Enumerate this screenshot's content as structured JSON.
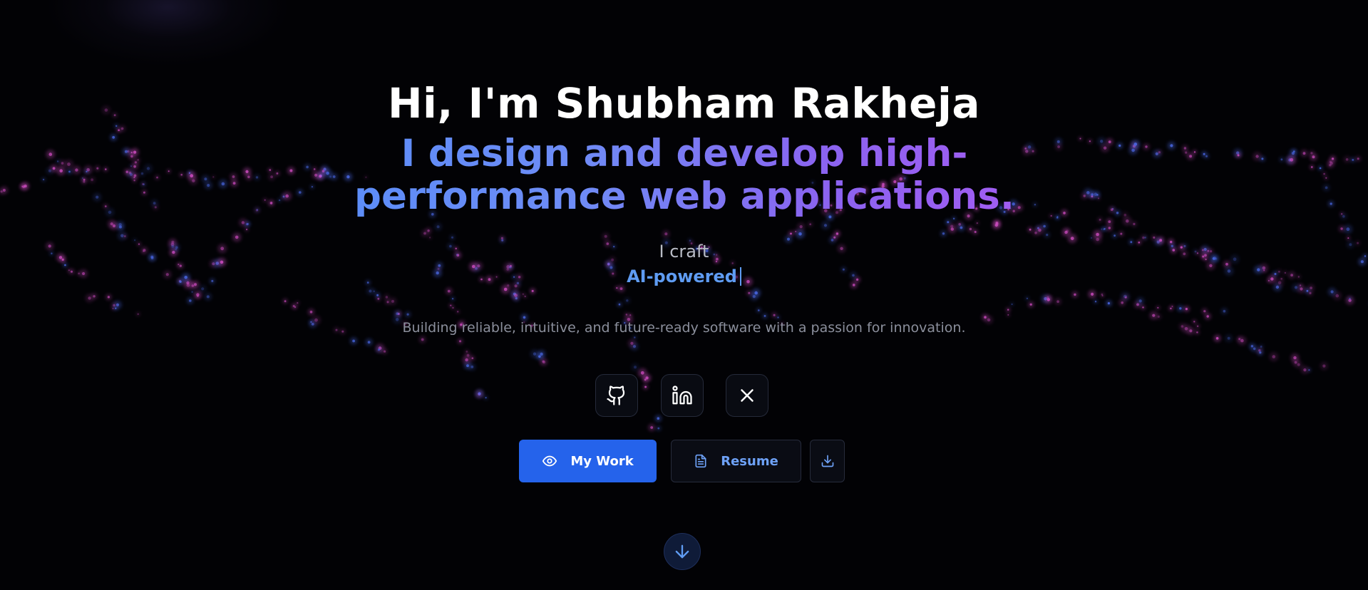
{
  "hero": {
    "greeting": "Hi, I'm Shubham Rakheja",
    "tagline_line1": "I design and develop high-",
    "tagline_line2": "performance web applications.",
    "craft_prefix": "I craft",
    "typed_word": "AI-powered",
    "subline": "Building reliable, intuitive, and future-ready software with a passion for innovation."
  },
  "social": [
    {
      "icon": "github-icon"
    },
    {
      "icon": "linkedin-icon"
    },
    {
      "icon": "x-icon"
    }
  ],
  "actions": {
    "primary_label": "My Work",
    "primary_icon": "eye-icon",
    "secondary_label": "Resume",
    "secondary_icon": "file-text-icon",
    "download_icon": "download-icon"
  },
  "scroll": {
    "icon": "arrow-down-icon"
  },
  "colors": {
    "background": "#020205",
    "accent_blue": "#2563eb",
    "gradient_start": "#5b8df8",
    "gradient_end": "#a45cf2",
    "particle_pink": "#d64fc8",
    "particle_blue": "#4d6df0"
  }
}
